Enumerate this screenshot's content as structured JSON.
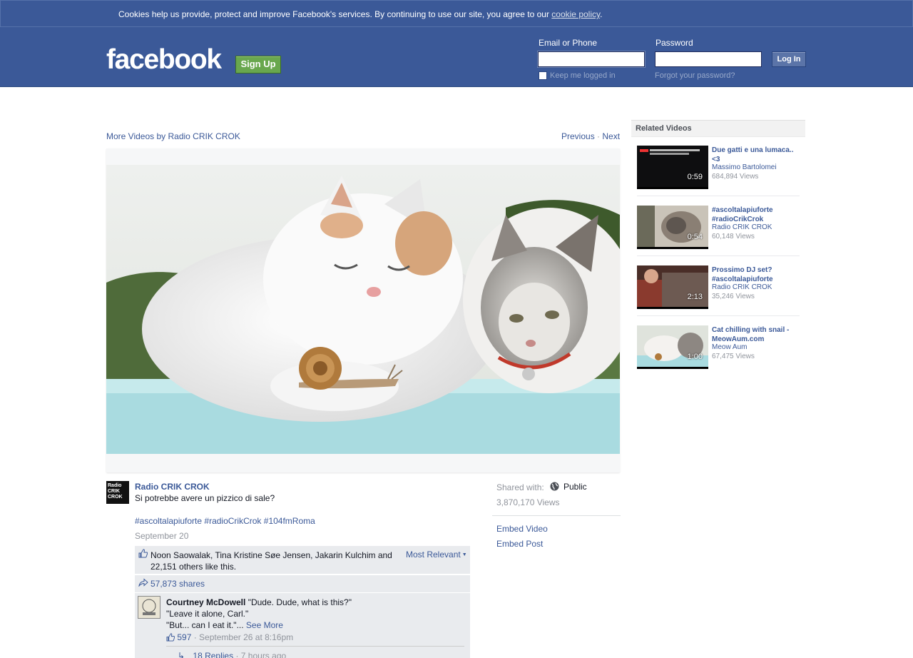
{
  "cookie_bar": {
    "text": "Cookies help us provide, protect and improve Facebook's services. By continuing to use our site, you agree to our",
    "link": "cookie policy",
    "end": "."
  },
  "header": {
    "logo": "facebook",
    "signup_label": "Sign Up",
    "email_label": "Email or Phone",
    "password_label": "Password",
    "login_label": "Log In",
    "keep_logged_in": "Keep me logged in",
    "forgot_password": "Forgot your password?"
  },
  "video_nav": {
    "more_videos": "More Videos by Radio CRIK CROK",
    "previous": "Previous",
    "separator": "·",
    "next": "Next"
  },
  "post": {
    "avatar_text": "Radio CRIK CROK",
    "page_name": "Radio CRIK CROK",
    "text": "Si potrebbe avere un pizzico di sale?",
    "hashtags": [
      "#ascoltalapiuforte",
      "#radioCrikCrok",
      "#104fmRoma"
    ],
    "date": "September 20",
    "likes_text": "Noon Saowalak, Tina Kristine Søe Jensen, Jakarin Kulchim and 22,151 others like this.",
    "sort_label": "Most Relevant",
    "shares": "57,873 shares",
    "comment": {
      "author": "Courtney McDowell",
      "line1": "\"Dude. Dude, what is this?\"",
      "line2": "\"Leave it alone, Carl.\"",
      "line3": "\"But... can I eat it.\"...",
      "see_more": "See More",
      "likes": "597",
      "time": "· September 26 at 8:16pm",
      "replies": "18 Replies",
      "replies_time": "· 7 hours ago"
    }
  },
  "side": {
    "shared_with": "Shared with:",
    "audience": "Public",
    "views": "3,870,170 Views",
    "embed_video": "Embed Video",
    "embed_post": "Embed Post"
  },
  "related": {
    "header": "Related Videos",
    "items": [
      {
        "title": "Due gatti e una lumaca.. <3",
        "channel": "Massimo Bartolomei",
        "views": "684,894 Views",
        "duration": "0:59"
      },
      {
        "title": "#ascoltalapiuforte #radioCrikCrok",
        "channel": "Radio CRIK CROK",
        "views": "60,148 Views",
        "duration": "0:54"
      },
      {
        "title": "Prossimo DJ set? #ascoltalapiuforte",
        "channel": "Radio CRIK CROK",
        "views": "35,246 Views",
        "duration": "2:13"
      },
      {
        "title": "Cat chilling with snail - MeowAum.com",
        "channel": "Meow Aum",
        "views": "67,475 Views",
        "duration": "1:00"
      }
    ]
  },
  "colors": {
    "brand": "#3b5998",
    "signup_green": "#69a74e",
    "link": "#3b5998",
    "muted": "#90949c"
  }
}
